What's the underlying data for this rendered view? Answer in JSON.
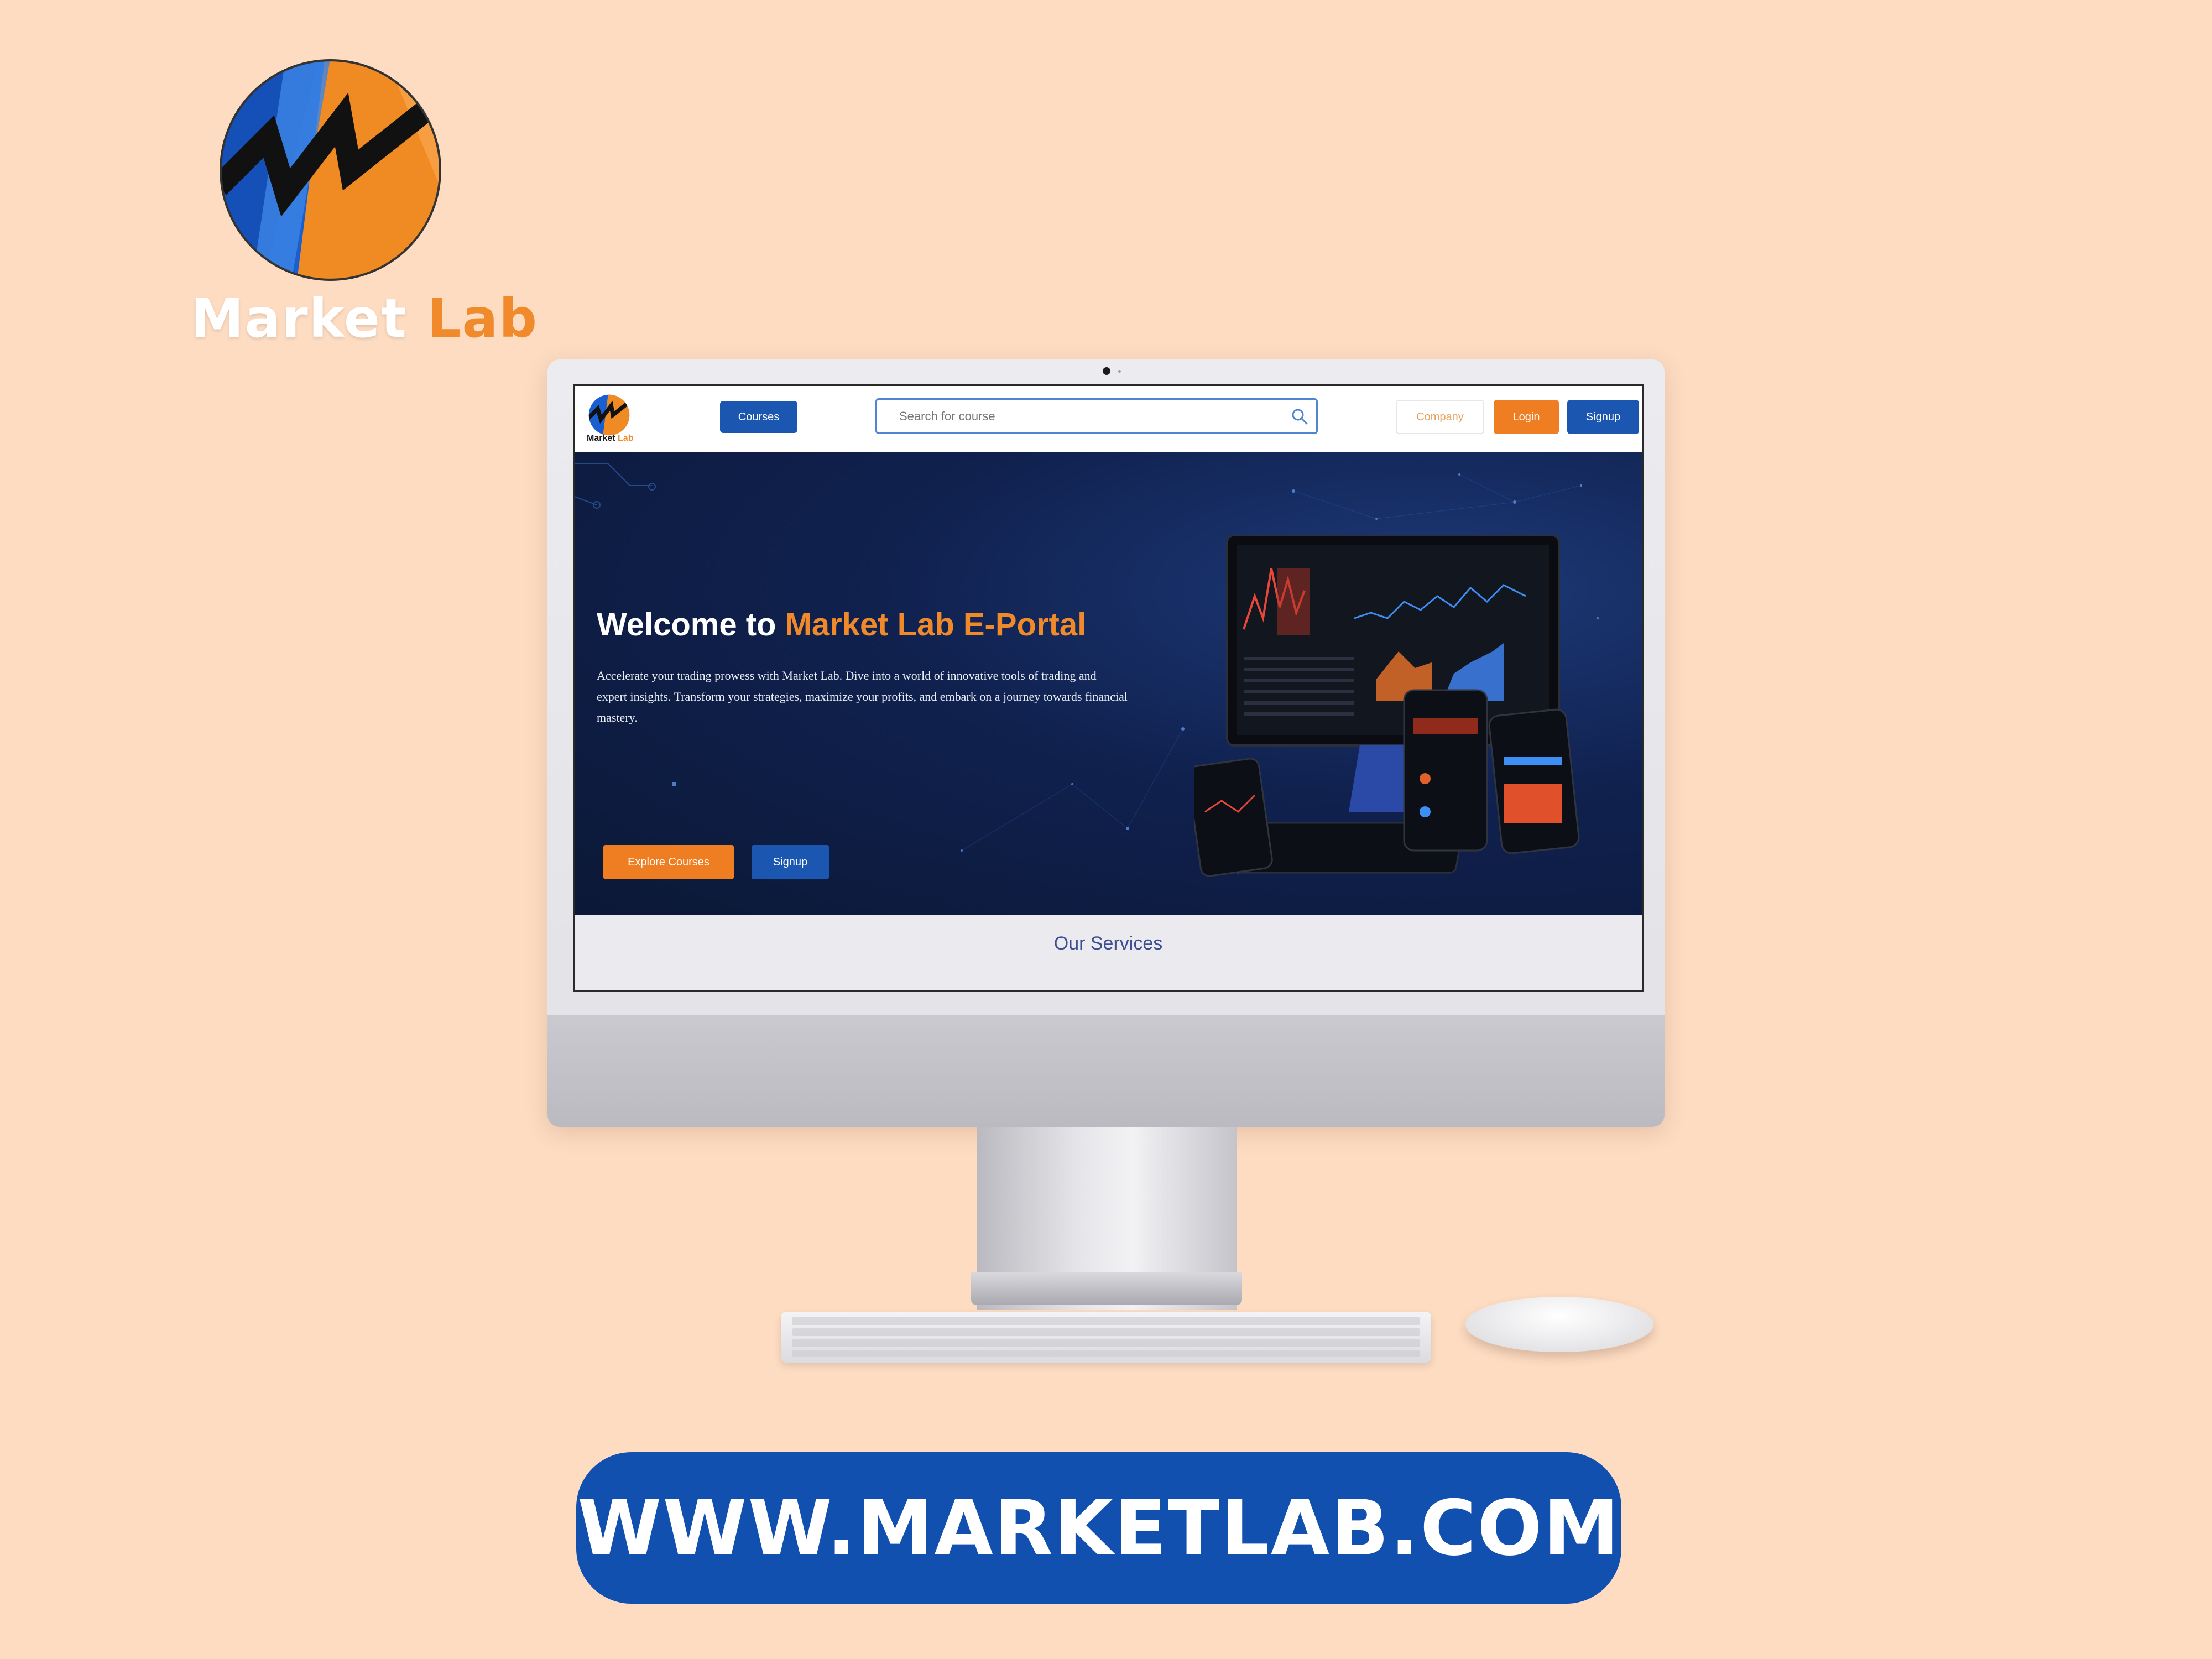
{
  "brand": {
    "word_primary": "Market",
    "word_secondary": "Lab"
  },
  "nav": {
    "logo_primary": "Market",
    "logo_secondary": "Lab",
    "courses_label": "Courses",
    "search_placeholder": "Search for course",
    "company_label": "Company",
    "login_label": "Login",
    "signup_label": "Signup"
  },
  "hero": {
    "title_prefix": "Welcome to ",
    "title_accent": "Market Lab E-Portal",
    "description": "Accelerate your trading prowess with Market Lab. Dive into a world of innovative tools of trading and expert insights. Transform your strategies, maximize your profits, and embark on a journey towards financial mastery.",
    "explore_label": "Explore Courses",
    "signup_label": "Signup"
  },
  "services": {
    "title": "Our Services"
  },
  "footer": {
    "url": "WWW.MARKETLAB.COM"
  },
  "colors": {
    "background": "#fddcc2",
    "brand_blue": "#1b56b0",
    "brand_orange": "#ef7d22",
    "hero_navy": "#10214f"
  },
  "icons": [
    "market-lab-logo-icon",
    "search-icon"
  ]
}
